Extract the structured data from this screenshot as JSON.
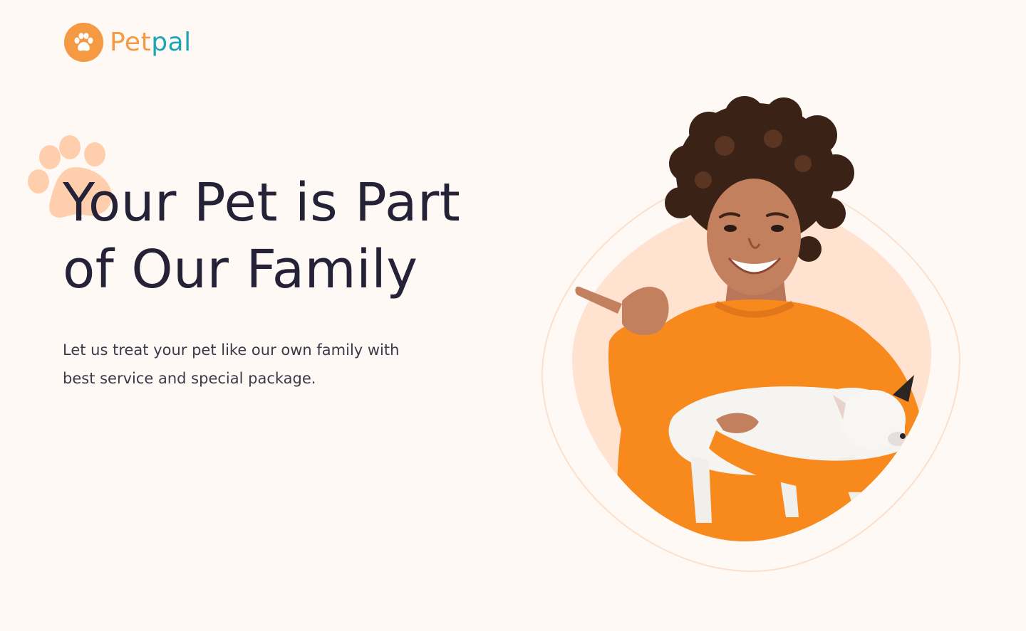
{
  "brand": {
    "name_part1": "Pet",
    "name_part2": "pal",
    "logo_icon": "paw-icon",
    "color_orange": "#f59a42",
    "color_teal": "#1ba6b4"
  },
  "hero": {
    "title_line1": "Your Pet is Part",
    "title_line2": "of Our Family",
    "subtitle_line1": "Let us treat your pet like our own family with",
    "subtitle_line2": "best service and special package.",
    "decor_icon": "paw-print-icon",
    "image": "woman-holding-puppy-photo"
  },
  "colors": {
    "background": "#fff9f5",
    "title_text": "#252238",
    "body_text": "#3b3a4a",
    "blob": "#ffe2cf",
    "decor_paw": "#ffcfad",
    "sweater": "#f7891d"
  }
}
